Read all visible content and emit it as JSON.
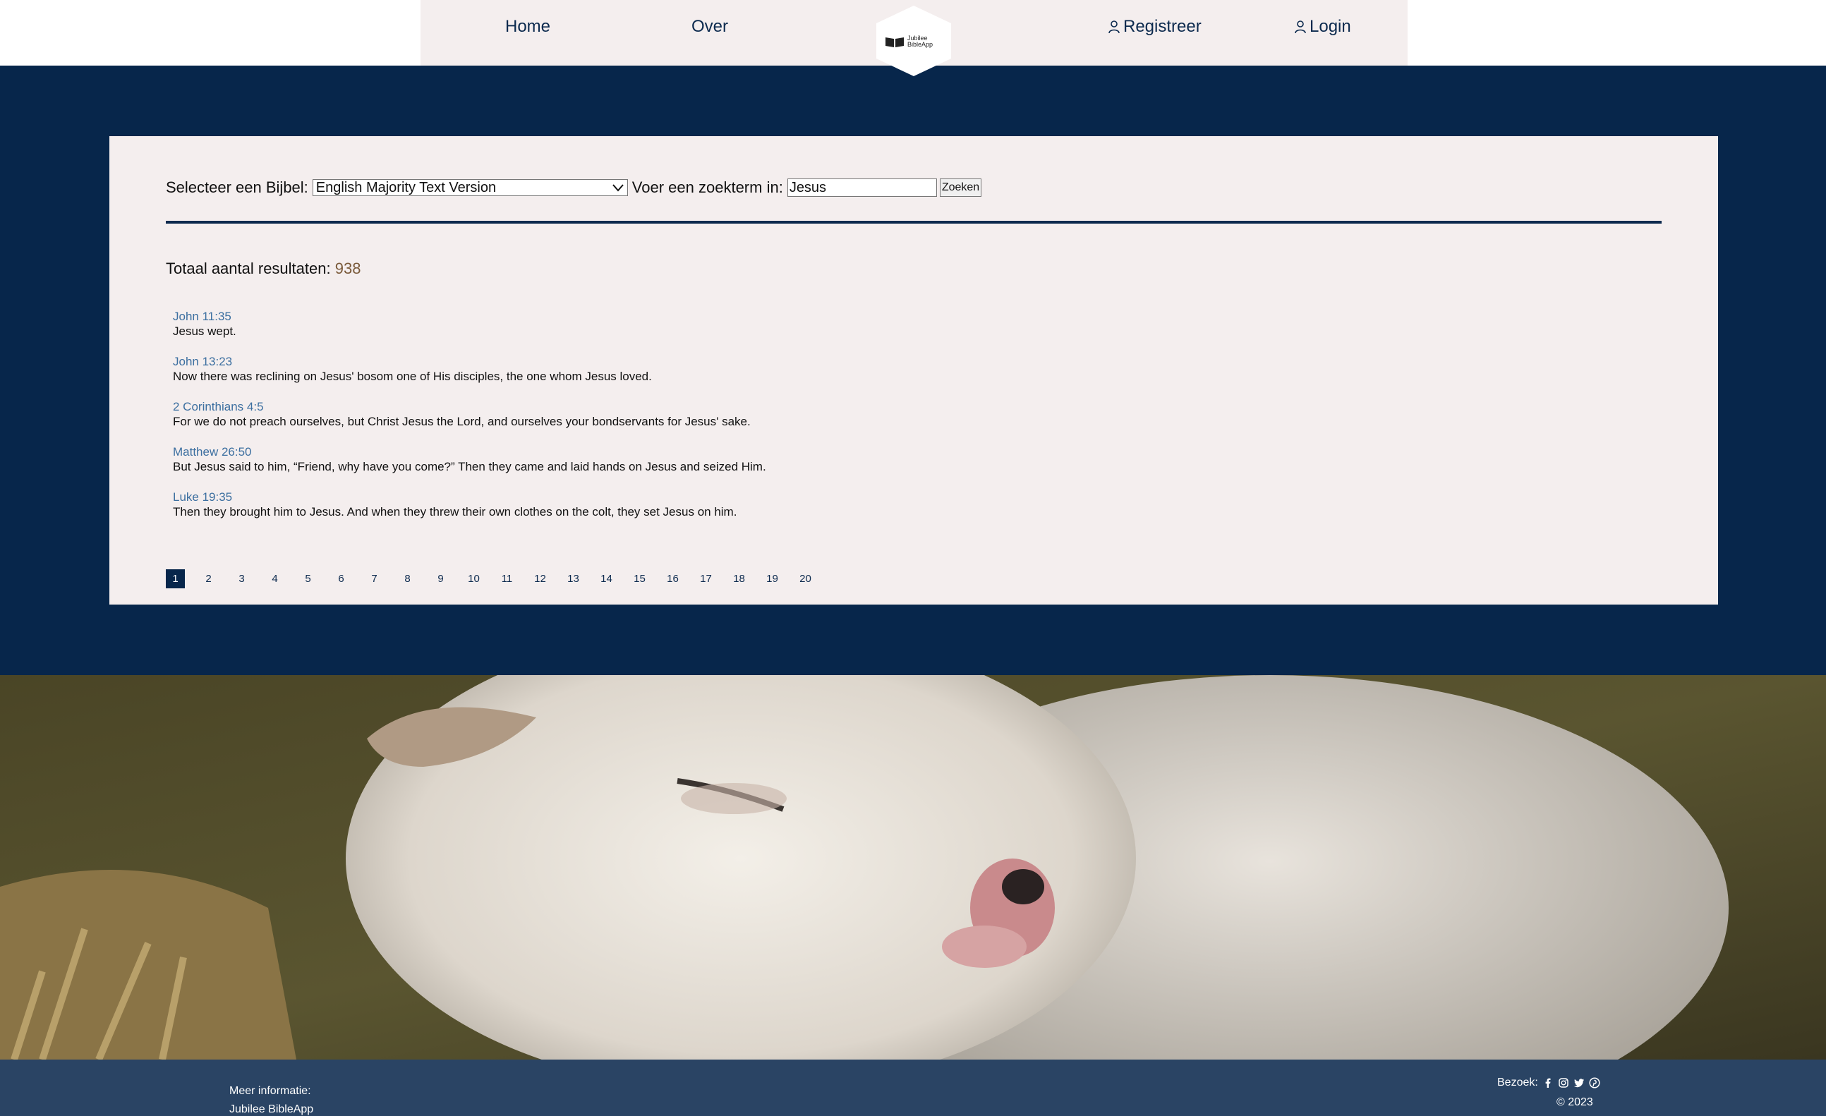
{
  "nav": {
    "home": "Home",
    "over": "Over",
    "logo_line1": "Jubilee",
    "logo_line2": "BibleApp",
    "register": "Registreer",
    "login": "Login"
  },
  "search": {
    "bible_label": "Selecteer een Bijbel:",
    "bible_selected": "English Majority Text Version",
    "term_label": "Voer een zoekterm in:",
    "term_value": "Jesus",
    "button": "Zoeken"
  },
  "results_summary": {
    "label": "Totaal aantal resultaten:",
    "count": "938"
  },
  "results": [
    {
      "ref": "John 11:35",
      "text": "Jesus wept."
    },
    {
      "ref": "John 13:23",
      "text": "Now there was reclining on Jesus' bosom one of His disciples, the one whom Jesus loved."
    },
    {
      "ref": "2 Corinthians 4:5",
      "text": "For we do not preach ourselves, but Christ Jesus the Lord, and ourselves your bondservants for Jesus' sake."
    },
    {
      "ref": "Matthew 26:50",
      "text": "But Jesus said to him, “Friend, why have you come?” Then they came and laid hands on Jesus and seized Him."
    },
    {
      "ref": "Luke 19:35",
      "text": "Then they brought him to Jesus. And when they threw their own clothes on the colt, they set Jesus on him."
    }
  ],
  "pagination": {
    "pages": [
      "1",
      "2",
      "3",
      "4",
      "5",
      "6",
      "7",
      "8",
      "9",
      "10",
      "11",
      "12",
      "13",
      "14",
      "15",
      "16",
      "17",
      "18",
      "19",
      "20"
    ],
    "active": "1"
  },
  "footer": {
    "info_title": "Meer informatie:",
    "app_name": "Jubilee BibleApp",
    "visit_label": "Bezoek:",
    "copyright": "© 2023",
    "social_icons": [
      "facebook-icon",
      "instagram-icon",
      "twitter-icon",
      "pinterest-icon"
    ]
  },
  "colors": {
    "navy": "#07264b",
    "panel": "#f4eeee",
    "link": "#3c6fa0"
  }
}
